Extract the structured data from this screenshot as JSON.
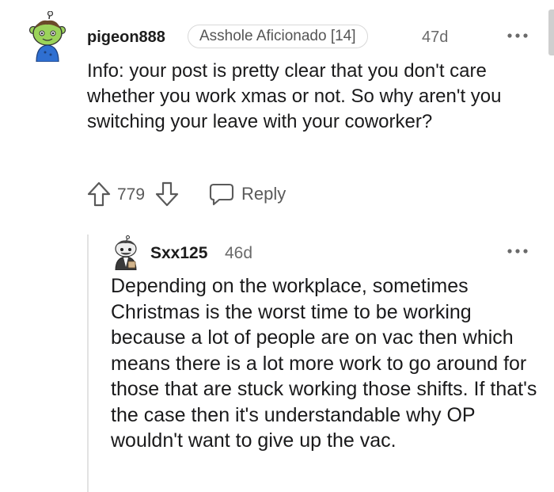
{
  "comment": {
    "author": "pigeon888",
    "flair": "Asshole Aficionado [14]",
    "age": "47d",
    "body": "Info: your post is pretty clear that you don't care whether you work xmas or not. So why aren't you switching your leave with your coworker?",
    "votes": "779",
    "reply_label": "Reply",
    "avatar_icon": "snoo-avatar-green-icon",
    "more_icon": "more-options-icon"
  },
  "reply": {
    "author": "Sxx125",
    "age": "46d",
    "body": "Depending on the workplace, sometimes Christmas is the worst time to be working because a lot of people are on vac then which means there is a lot more work to go around for those that are stuck working those shifts. If that's the case then it's understandable why OP wouldn't want to give up the vac.",
    "avatar_icon": "snoo-avatar-suit-icon",
    "more_icon": "more-options-icon"
  },
  "colors": {
    "text": "#1a1a1b",
    "meta": "#6a6a6a",
    "flair_border": "#d8d8d8",
    "icon": "#5a5a5a",
    "thread_line": "#e2e2e2",
    "avatar_green": "#9bd35a",
    "avatar_blue": "#2f6fd1"
  }
}
